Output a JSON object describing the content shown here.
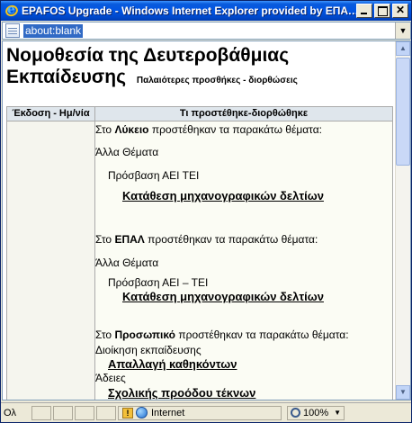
{
  "window": {
    "title": "EPAFOS Upgrade - Windows Internet Explorer provided by ΕΠΑΦΟΣ",
    "close_glyph": "✕"
  },
  "address": {
    "value": "about:blank",
    "dropdown_glyph": "▼"
  },
  "page": {
    "title_main": "Νομοθεσία της Δευτεροβάθμιας Εκπαίδευσης",
    "title_sub": "Παλαιότερες προσθήκες - διορθώσεις"
  },
  "table": {
    "headers": [
      "Έκδοση - Ημ/νία",
      "Τι προστέθηκε-διορθώθηκε"
    ],
    "sections": {
      "lyceum": {
        "prefix": "Στο",
        "keyword": "Λύκειο",
        "suffix": "προστέθηκαν τα παρακάτω θέματα:",
        "category": "Άλλα Θέματα",
        "subcategory": "Πρόσβαση ΑΕΙ ΤΕΙ",
        "link": "Κατάθεση μηχανογραφικών δελτίων"
      },
      "epal": {
        "prefix": "Στο",
        "keyword": "ΕΠΑΛ",
        "suffix": "προστέθηκαν τα παρακάτω θέματα:",
        "category": "Άλλα Θέματα",
        "subcategory": "Πρόσβαση ΑΕΙ – ΤΕΙ",
        "link": "Κατάθεση μηχανογραφικών δελτίων"
      },
      "personnel": {
        "prefix": "Στο",
        "keyword": "Προσωπικό",
        "suffix": "προστέθηκαν τα παρακάτω θέματα:",
        "category1": "Διοίκηση εκπαίδευσης",
        "link1": "Απαλλαγή καθηκόντων",
        "category2": "Άδειες",
        "link2": "Σχολικής προόδου τέκνων"
      }
    }
  },
  "scrollbar": {
    "up_glyph": "▲",
    "down_glyph": "▼"
  },
  "status": {
    "left_text": "Ολ",
    "zone": "Internet",
    "zoom": "100%",
    "zoom_drop": "▼"
  }
}
